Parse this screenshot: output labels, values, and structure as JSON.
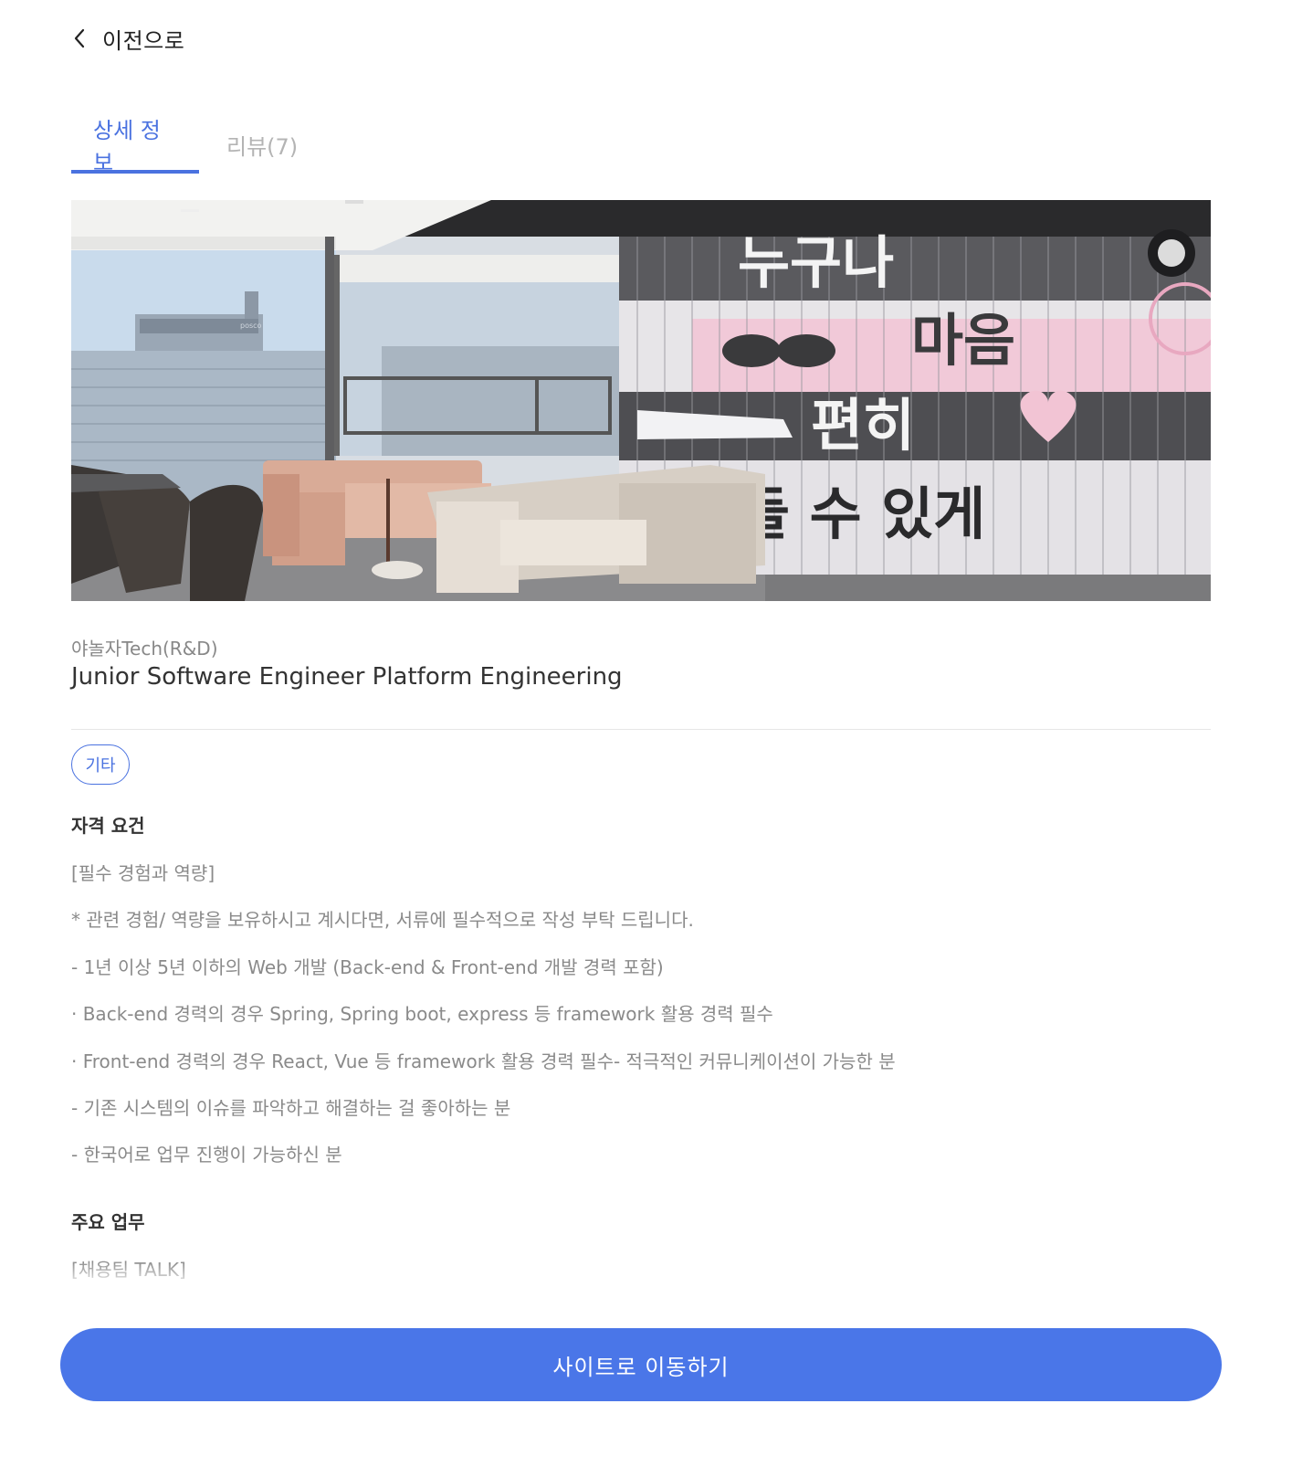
{
  "nav": {
    "back_label": "이전으로",
    "back_icon": "chevron-left-icon"
  },
  "tabs": [
    {
      "label": "상세 정보",
      "active": true
    },
    {
      "label": "리뷰(7)",
      "active": false
    }
  ],
  "hero": {
    "wall_text": [
      "누구나",
      "마음",
      "편히",
      "들 수 있게"
    ],
    "building_sign": "posco"
  },
  "job": {
    "company": "야놀자Tech(R&D)",
    "title": "Junior Software Engineer Platform Engineering",
    "tag": "기타"
  },
  "sections": {
    "qualifications": {
      "heading": "자격 요건",
      "lines": [
        "[필수 경험과 역량]",
        "* 관련 경험/ 역량을 보유하시고 계시다면, 서류에 필수적으로 작성 부탁 드립니다.",
        "- 1년 이상 5년 이하의 Web 개발 (Back-end & Front-end 개발 경력 포함)",
        "· Back-end 경력의 경우 Spring, Spring boot, express 등 framework 활용 경력 필수",
        "· Front-end 경력의 경우 React, Vue 등 framework 활용 경력 필수- 적극적인 커뮤니케이션이 가능한 분",
        "- 기존 시스템의 이슈를 파악하고 해결하는 걸 좋아하는 분",
        "- 한국어로 업무 진행이 가능하신 분"
      ]
    },
    "duties": {
      "heading": "주요 업무",
      "lines": [
        "[채용팀 TALK]"
      ]
    }
  },
  "cta": {
    "label": "사이트로 이동하기"
  },
  "colors": {
    "accent": "#4a72e0",
    "cta": "#4a76e8"
  }
}
